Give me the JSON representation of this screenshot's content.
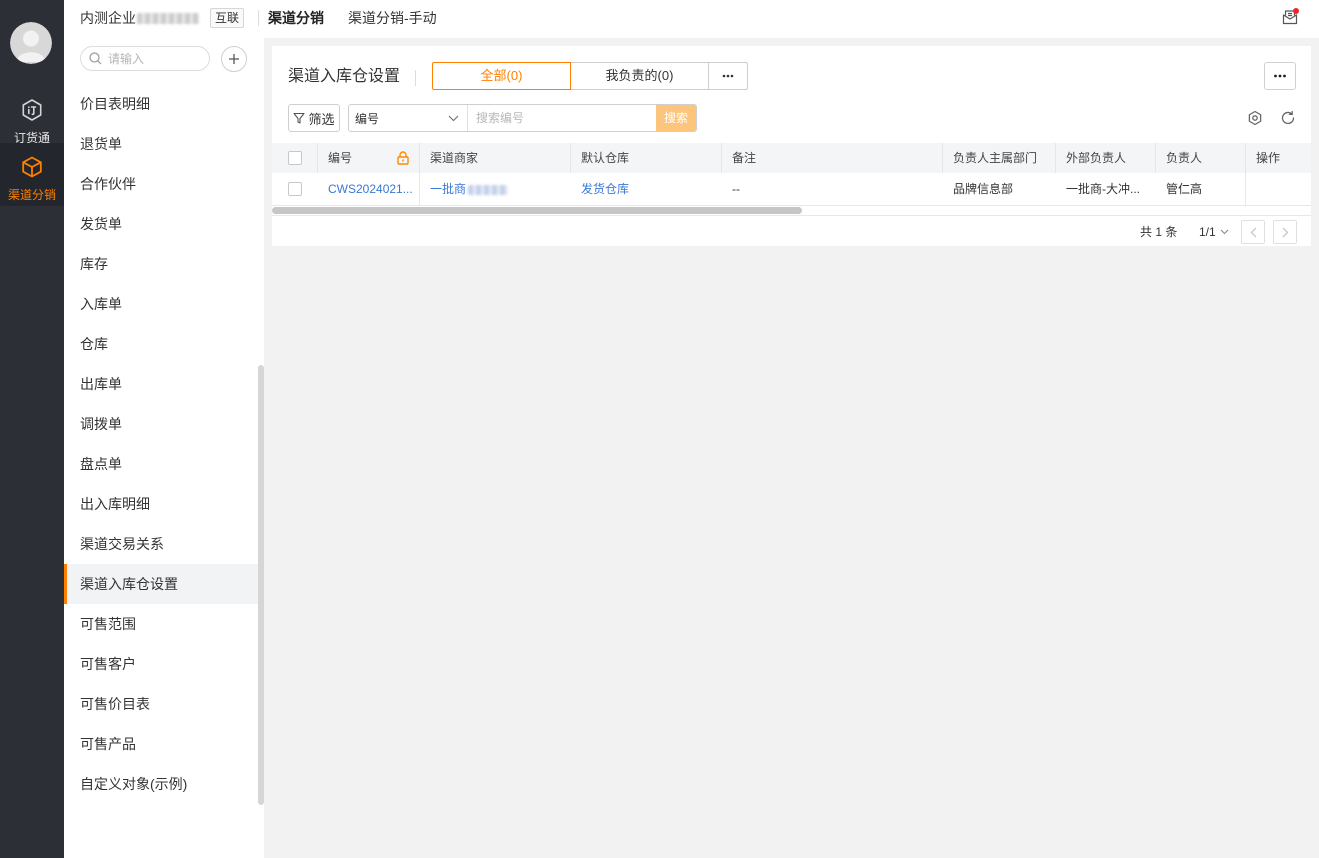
{
  "colors": {
    "accent": "#ff8000",
    "rail_background": "#2c2f36",
    "link": "#3a78d6",
    "search_button": "#fdc57c",
    "notification_dot": "#f5222d"
  },
  "rail": {
    "avatar_icon": "user-avatar-icon",
    "items": [
      {
        "label": "订货通",
        "icon": "order-app-icon",
        "active": false
      },
      {
        "label": "渠道分销",
        "icon": "cube-icon",
        "active": true
      }
    ]
  },
  "header": {
    "tenant_name": "内测企业",
    "tenant_badge": "互联",
    "app_title": "渠道分销",
    "view_name": "渠道分销-手动",
    "notification_icon": "mail-icon"
  },
  "sidebar": {
    "search_icon": "search-icon",
    "search_placeholder": "请输入",
    "add_icon": "plus-icon",
    "active_index": 12,
    "items": [
      "价目表明细",
      "退货单",
      "合作伙伴",
      "发货单",
      "库存",
      "入库单",
      "仓库",
      "出库单",
      "调拨单",
      "盘点单",
      "出入库明细",
      "渠道交易关系",
      "渠道入库仓设置",
      "可售范围",
      "可售客户",
      "可售价目表",
      "可售产品",
      "自定义对象(示例)"
    ]
  },
  "page": {
    "title": "渠道入库仓设置",
    "tabs": [
      {
        "label": "全部(0)",
        "selected": true
      },
      {
        "label": "我负责的(0)",
        "selected": false
      }
    ],
    "tabs_more_icon": "more-icon",
    "actions_more_icon": "more-icon",
    "toolbar": {
      "filter_icon": "filter-icon",
      "filter_label": "筛选",
      "field_select_value": "编号",
      "search_placeholder": "搜索编号",
      "search_label": "搜索",
      "settings_icon": "settings-icon",
      "refresh_icon": "refresh-icon"
    },
    "table": {
      "columns": [
        "编号",
        "渠道商家",
        "默认仓库",
        "备注",
        "负责人主属部门",
        "外部负责人",
        "负责人",
        "操作"
      ],
      "locked_column_icon": "lock-icon",
      "rows": [
        {
          "code": "CWS2024021...",
          "partner": "一批商",
          "warehouse": "发货仓库",
          "remark": "--",
          "owner_department": "品牌信息部",
          "external_owner": "一批商-大冲...",
          "owner": "管仁高"
        }
      ]
    },
    "pagination": {
      "total_label": "共 1 条",
      "page_label": "1/1"
    }
  }
}
